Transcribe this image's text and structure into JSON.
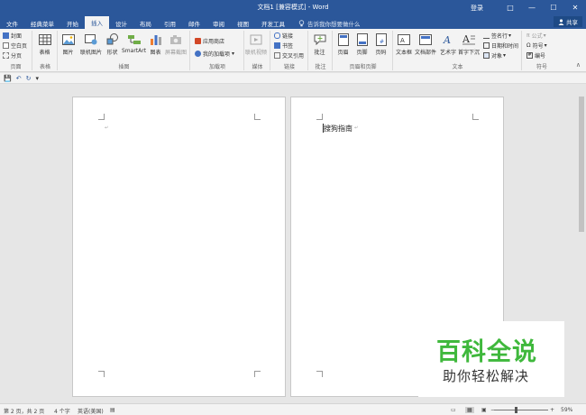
{
  "window": {
    "title": "文档1 [兼容模式] - Word",
    "login": "登录",
    "restore_icon": "□",
    "minimize_icon": "—",
    "maximize_icon": "☐",
    "close_icon": "✕"
  },
  "tabs": [
    "文件",
    "经典菜单",
    "开始",
    "插入",
    "设计",
    "布局",
    "引用",
    "邮件",
    "审阅",
    "视图",
    "开发工具"
  ],
  "tellme": "告诉我你想要做什么",
  "share": "共享",
  "ribbon": {
    "pages": {
      "label": "页面",
      "cover": "封面",
      "blank": "空白页",
      "break": "分页"
    },
    "tables": {
      "label": "表格",
      "table": "表格"
    },
    "illustrations": {
      "label": "插图",
      "picture": "图片",
      "online_picture": "联机图片",
      "shapes": "形状",
      "smartart": "SmartArt",
      "chart": "图表",
      "screenshot": "屏幕截图"
    },
    "addins": {
      "label": "加载项",
      "store": "应用商店",
      "my_addins": "我的加载项"
    },
    "media": {
      "label": "媒体",
      "online_video": "联机视频"
    },
    "links": {
      "label": "链接",
      "link": "链接",
      "bookmark": "书签",
      "crossref": "交叉引用"
    },
    "comments": {
      "label": "批注",
      "comment": "批注"
    },
    "header_footer": {
      "label": "页眉和页脚",
      "header": "页眉",
      "footer": "页脚",
      "page_number": "页码"
    },
    "text": {
      "label": "文本",
      "textbox": "文本框",
      "quickparts": "文档部件",
      "wordart": "艺术字",
      "dropcap": "首字下沉",
      "signature": "签名行",
      "datetime": "日期和时间",
      "object": "对象"
    },
    "symbols": {
      "label": "符号",
      "equation": "公式",
      "symbol": "符号",
      "number": "编号"
    }
  },
  "quick_access": {
    "save": "💾",
    "undo": "↶",
    "redo": "↻",
    "customize": "▾"
  },
  "document": {
    "page2_text": "搜狗指南"
  },
  "status": {
    "page": "第 2 页，共 2 页",
    "words": "4 个字",
    "language": "英语(美国)",
    "zoom": "59%",
    "zoom_minus": "−",
    "zoom_plus": "+"
  },
  "watermark": {
    "title": "百科全说",
    "subtitle": "助你轻松解决"
  },
  "colors": {
    "brand": "#2b579a",
    "ribbon": "#f3f3f3",
    "canvas": "#e6e6e6",
    "watermark_green": "#3fb83c"
  }
}
